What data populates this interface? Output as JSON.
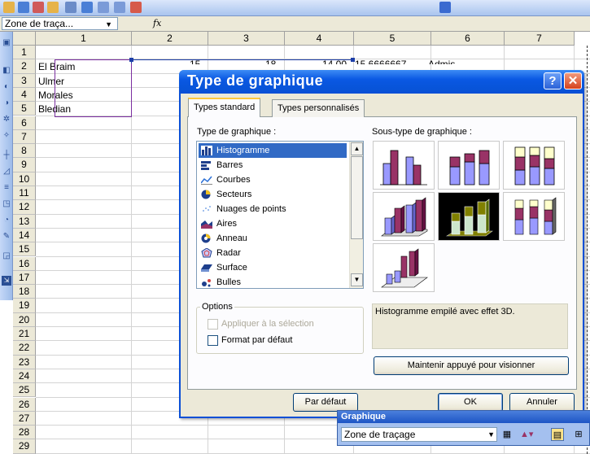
{
  "formula_bar": {
    "name_box_value": "Zone de traça...",
    "name_box_arrow": "▼",
    "fx_label": "fx"
  },
  "grid": {
    "columns": [
      "1",
      "2",
      "3",
      "4",
      "5",
      "6",
      "7"
    ],
    "rows": [
      "1",
      "2",
      "3",
      "4",
      "5",
      "6",
      "7",
      "8",
      "9",
      "10",
      "11",
      "12",
      "13",
      "14",
      "15",
      "16",
      "17",
      "18",
      "19",
      "20",
      "21",
      "22",
      "23",
      "24",
      "25",
      "26",
      "27",
      "28",
      "29"
    ],
    "cells": {
      "r2c1": "El Braim",
      "r3c1": "Ulmer",
      "r4c1": "Morales",
      "r5c1": "Bledian",
      "r2c2_partial": "15",
      "r2c3_partial": "18",
      "r2c4_partial": "14,00",
      "r2c5_partial": "15,6666667",
      "r2c6_partial": "Admis"
    }
  },
  "dialog": {
    "title": "Type de graphique",
    "help_label": "?",
    "close_label": "✕",
    "tabs": [
      "Types standard",
      "Types personnalisés"
    ],
    "type_group_label": "Type de graphique :",
    "subtype_group_label": "Sous-type de graphique :",
    "chart_types": [
      {
        "label": "Histogramme",
        "icon": "histogram-icon",
        "selected": true
      },
      {
        "label": "Barres",
        "icon": "bar-chart-icon",
        "selected": false
      },
      {
        "label": "Courbes",
        "icon": "line-chart-icon",
        "selected": false
      },
      {
        "label": "Secteurs",
        "icon": "pie-chart-icon",
        "selected": false
      },
      {
        "label": "Nuages de points",
        "icon": "scatter-chart-icon",
        "selected": false
      },
      {
        "label": "Aires",
        "icon": "area-chart-icon",
        "selected": false
      },
      {
        "label": "Anneau",
        "icon": "doughnut-chart-icon",
        "selected": false
      },
      {
        "label": "Radar",
        "icon": "radar-chart-icon",
        "selected": false
      },
      {
        "label": "Surface",
        "icon": "surface-chart-icon",
        "selected": false
      },
      {
        "label": "Bulles",
        "icon": "bubble-chart-icon",
        "selected": false
      }
    ],
    "options_label": "Options",
    "option_apply_selection": "Appliquer à la sélection",
    "option_default_format": "Format par défaut",
    "description": "Histogramme empilé avec effet 3D.",
    "preview_button": "Maintenir appuyé pour visionner",
    "default_button": "Par défaut",
    "ok_button": "OK",
    "cancel_button": "Annuler",
    "colors": {
      "bar_purple": "#993366",
      "bar_blue": "#9999ff",
      "bar_lilac": "#ccccff",
      "bar_yellow": "#ffffcc",
      "bar_green": "#cce6cc",
      "bar_olive": "#808000"
    }
  },
  "chart_toolbar": {
    "title": "Graphique",
    "combo_value": "Zone de traçage",
    "combo_arrow": "▼"
  }
}
